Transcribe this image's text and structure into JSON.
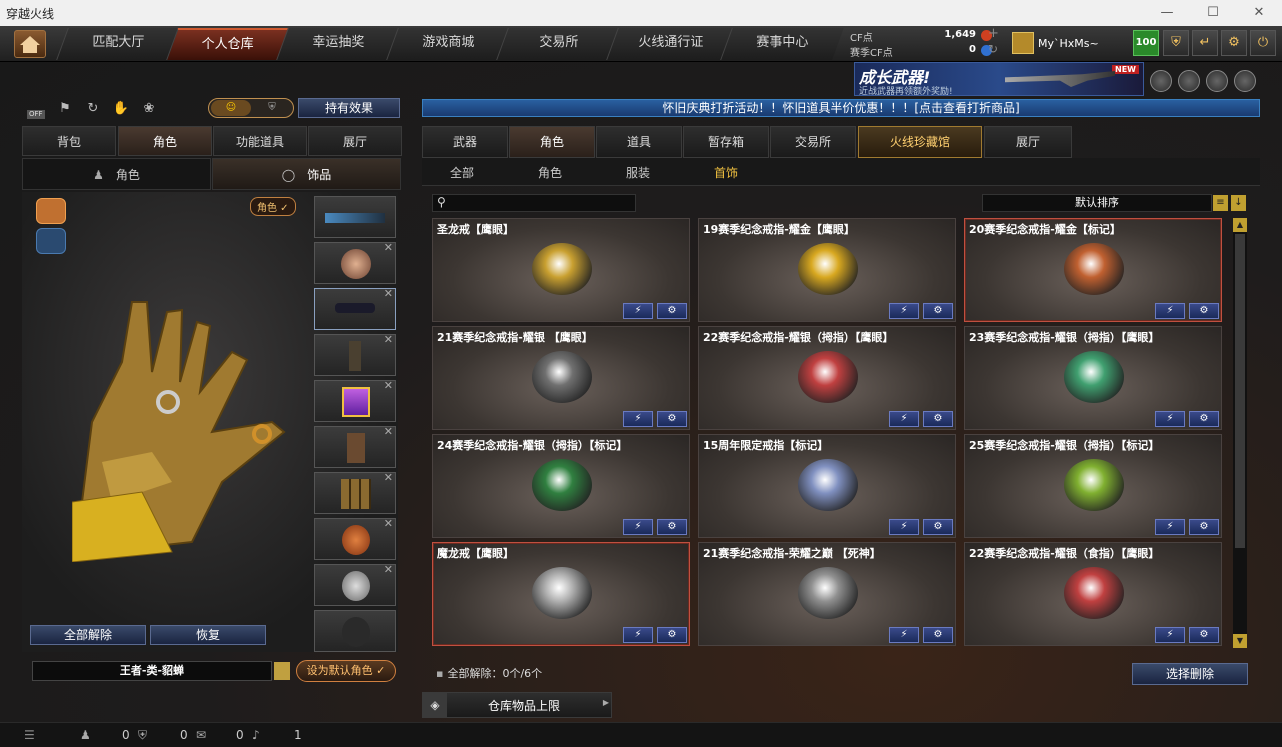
{
  "window": {
    "title": "穿越火线",
    "min": "—",
    "max": "☐",
    "close": "✕"
  },
  "nav": {
    "tabs": [
      "匹配大厅",
      "个人仓库",
      "幸运抽奖",
      "游戏商城",
      "交易所",
      "火线通行证",
      "赛事中心"
    ],
    "active": 1
  },
  "currency": {
    "cf_label": "CF点",
    "cf_value": "1,649",
    "scf_label": "赛季CF点",
    "scf_value": "0",
    "plus": "+",
    "refresh": "↻"
  },
  "user": {
    "name": "My`HxMs~",
    "level": "100"
  },
  "ad": {
    "title": "成长武器!",
    "subtitle": "近战武器再领额外奖励!",
    "badge": "NEW"
  },
  "toolbar": {
    "off_label": "OFF",
    "effects_button": "持有效果"
  },
  "left": {
    "tabs": [
      "背包",
      "角色",
      "功能道具",
      "展厅"
    ],
    "active_tab": 1,
    "subtabs": [
      "角色",
      "饰品"
    ],
    "active_subtab": 1,
    "role_badge": "角色 ✓",
    "unequip_all": "全部解除",
    "restore": "恢复",
    "character_name": "王者-类-貂蝉",
    "set_default": "设为默认角色 ✓"
  },
  "right": {
    "notice": "怀旧庆典打折活动！！怀旧道具半价优惠！！！[点击查看打折商品]",
    "tabs": [
      "武器",
      "角色",
      "道具",
      "暂存箱",
      "交易所",
      "火线珍藏馆",
      "展厅"
    ],
    "active_tab": 1,
    "special_tab": 5,
    "subtabs": [
      "全部",
      "角色",
      "服装",
      "首饰"
    ],
    "active_subtab": 3,
    "search_placeholder": "",
    "sort_label": "默认排序",
    "items": [
      {
        "name": "圣龙戒【鹰眼】",
        "color": "#c9a030",
        "highlight": false
      },
      {
        "name": "19赛季纪念戒指-耀金【鹰眼】",
        "color": "#d8a820",
        "highlight": false
      },
      {
        "name": "20赛季纪念戒指-耀金【标记】",
        "color": "#c06030",
        "highlight": true
      },
      {
        "name": "21赛季纪念戒指-耀银 【鹰眼】",
        "color": "#707070",
        "highlight": false
      },
      {
        "name": "22赛季纪念戒指-耀银（拇指）【鹰眼】",
        "color": "#c04040",
        "highlight": false
      },
      {
        "name": "23赛季纪念戒指-耀银（拇指）【鹰眼】",
        "color": "#40a070",
        "highlight": false
      },
      {
        "name": "24赛季纪念戒指-耀银（拇指）【标记】",
        "color": "#308040",
        "highlight": false
      },
      {
        "name": "15周年限定戒指【标记】",
        "color": "#8090c0",
        "highlight": false
      },
      {
        "name": "25赛季纪念戒指-耀银（拇指）【标记】",
        "color": "#80b030",
        "highlight": false
      },
      {
        "name": "魔龙戒【鹰眼】",
        "color": "#b0b0b0",
        "highlight": true
      },
      {
        "name": "21赛季纪念戒指-荣耀之巅 【死神】",
        "color": "#909090",
        "highlight": false
      },
      {
        "name": "22赛季纪念戒指-耀银（食指）【鹰眼】",
        "color": "#c04040",
        "highlight": false
      }
    ],
    "btn_equip": "⚡",
    "btn_settings": "⚙",
    "clear_info": "全部解除：0个/6个",
    "select_delete": "选择删除",
    "storage_limit": "仓库物品上限"
  },
  "status": {
    "count1": "0",
    "count2": "0",
    "count3": "0",
    "count4": "1"
  }
}
